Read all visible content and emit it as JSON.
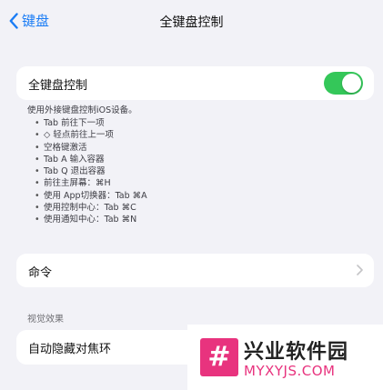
{
  "nav": {
    "back_label": "键盘",
    "title": "全键盘控制"
  },
  "main_toggle": {
    "label": "全键盘控制",
    "enabled": true,
    "on_color": "#34c759"
  },
  "description": {
    "intro": "使用外接键盘控制iOS设备。",
    "items": [
      "Tab 前往下一项",
      "◇ 轻点前往上一项",
      "空格键激活",
      "Tab A 输入容器",
      "Tab Q 退出容器",
      "前往主屏幕：⌘H",
      "使用 App切换器：Tab ⌘A",
      "使用控制中心：Tab ⌘C",
      "使用通知中心：Tab ⌘N"
    ]
  },
  "commands": {
    "label": "命令"
  },
  "visual_effects": {
    "header": "视觉效果",
    "auto_hide_label": "自动隐藏对焦环"
  },
  "watermark": {
    "logo_char": "#",
    "name": "兴业软件园",
    "url": "MYXYJS.COM",
    "accent": "#e8337e"
  },
  "colors": {
    "accent": "#1a7cf5",
    "background": "#f2f2f7"
  }
}
